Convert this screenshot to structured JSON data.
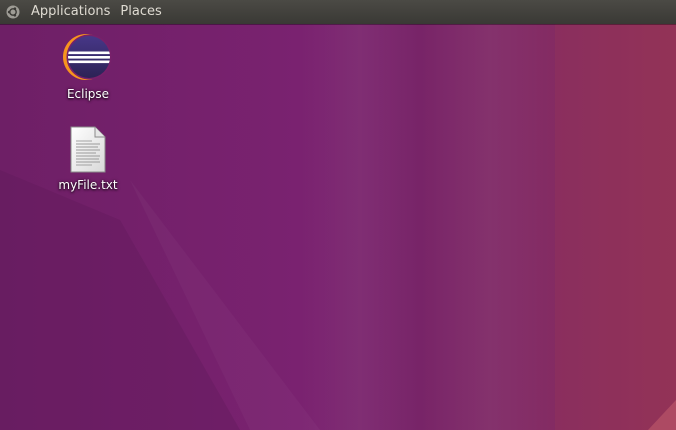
{
  "panel": {
    "menus": [
      {
        "label": "Applications"
      },
      {
        "label": "Places"
      }
    ],
    "logo_icon": "ubuntu-logo-icon"
  },
  "desktop": {
    "icons": [
      {
        "label": "Eclipse",
        "icon": "eclipse-icon"
      },
      {
        "label": "myFile.txt",
        "icon": "text-file-icon"
      }
    ]
  },
  "colors": {
    "panel_bg": "#3c3b37",
    "panel_text": "#dfdbd2",
    "wallpaper_base": "#78206a",
    "wallpaper_right": "#8c2c5a"
  }
}
